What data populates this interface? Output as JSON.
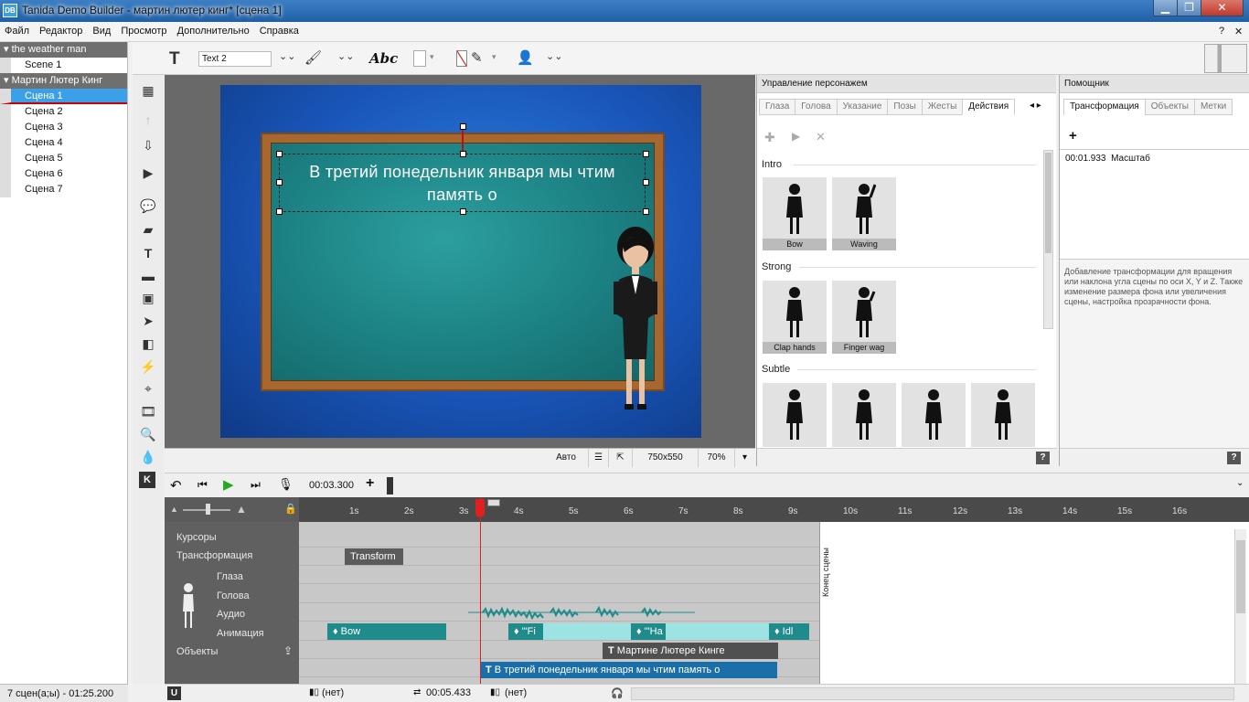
{
  "window": {
    "title": "Tanida Demo Builder - мартин лютер кинг* [сцена 1]",
    "logo": "DB",
    "min_label": "▁",
    "max_label": "❐",
    "close_label": "✕"
  },
  "menu": [
    "Файл",
    "Редактор",
    "Вид",
    "Просмотр",
    "Дополнительно",
    "Справка"
  ],
  "menu_help": "?",
  "menu_close": "✕",
  "projects": [
    {
      "name": "the weather man",
      "scenes": [
        "Scene 1"
      ]
    },
    {
      "name": "Мартин Лютер Кинг",
      "scenes": [
        "Сцена 1",
        "Сцена 2",
        "Сцена 3",
        "Сцена 4",
        "Сцена 5",
        "Сцена 6",
        "Сцена 7"
      ]
    }
  ],
  "selected_scene": "Сцена 1",
  "left_status": "7 сцен(а;ы) - 01:25.200",
  "toolbar": {
    "text_name": "Text 2",
    "font_sample": "Abc"
  },
  "slide": {
    "text": "В третий понедельник января мы чтим память о"
  },
  "canvas_status": {
    "mode": "Авто",
    "resolution": "750x550",
    "zoom": "70%"
  },
  "char_panel": {
    "title": "Управление персонажем",
    "tabs": [
      "Глаза",
      "Голова",
      "Указание",
      "Позы",
      "Жесты",
      "Действия"
    ],
    "active_tab": "Действия",
    "sections": [
      {
        "name": "Intro",
        "items": [
          "Bow",
          "Waving"
        ]
      },
      {
        "name": "Strong",
        "items": [
          "Clap hands",
          "Finger wag"
        ]
      },
      {
        "name": "Subtle",
        "items": [
          "",
          "",
          "",
          ""
        ]
      }
    ],
    "help_btn": "?"
  },
  "help_panel": {
    "title": "Помощник",
    "tabs": [
      "Трансформация",
      "Объекты",
      "Метки"
    ],
    "active_tab": "Трансформация",
    "entry_time": "00:01.933",
    "entry_name": "Масштаб",
    "description": "Добавление трансформации для вращения или наклона угла сцены по оси X, Y и Z. Также изменение размера фона или увеличения сцены, настройка прозрачности фона.",
    "help_btn": "?"
  },
  "timeline": {
    "current_time": "00:03.300",
    "ticks": [
      "1s",
      "2s",
      "3s",
      "4s",
      "5s",
      "6s",
      "7s",
      "8s",
      "9s",
      "10s",
      "11s",
      "12s",
      "13s",
      "14s",
      "15s",
      "16s"
    ],
    "tracks": [
      "Курсоры",
      "Трансформация",
      "Глаза",
      "Голова",
      "Аудио",
      "Анимация",
      "Объекты"
    ],
    "end_label": "Конец сцены",
    "clips": {
      "transform": "Transform",
      "anim1": "Bow",
      "anim2": "'\"Fi",
      "anim3": "'\"Ha",
      "anim4": "Idl",
      "obj1": "Мартине Лютере Кинге",
      "obj2": "В третий понедельник января мы чтим память о"
    }
  },
  "bottom": {
    "left_none": "(нет)",
    "time": "00:05.433",
    "right_none": "(нет)"
  },
  "colors": {
    "accent": "#3ba0e8",
    "clip": "#1f8b8b",
    "clip_light": "#9de3e3",
    "obj_selected": "#1b6fa8",
    "playhead": "#e0201f",
    "ruler_bar": "#f07a1a"
  }
}
